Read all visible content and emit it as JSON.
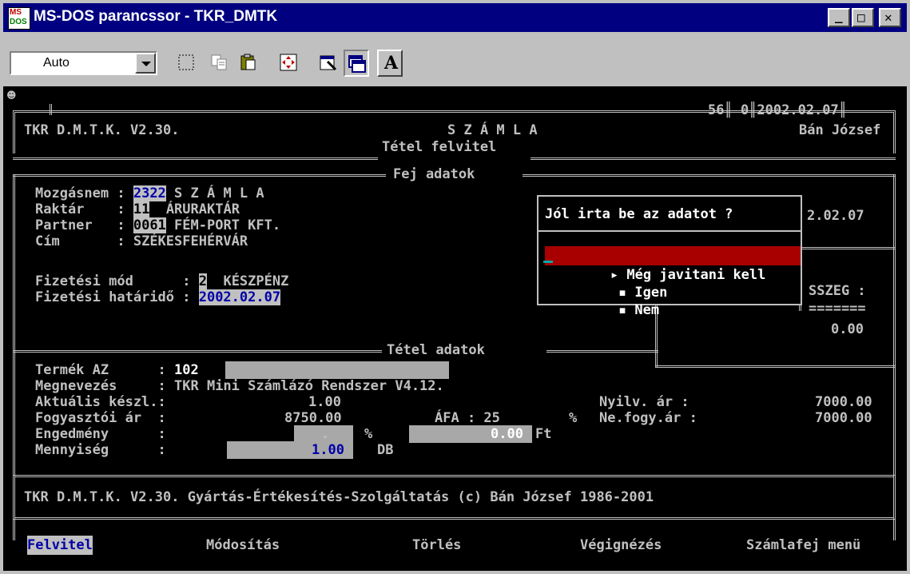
{
  "window": {
    "title": "MS-DOS parancssor - TKR_DMTK",
    "app_icon_top": "MS",
    "app_icon_bottom": "DOS",
    "minimize_glyph": "_",
    "maximize_glyph": "□",
    "close_glyph": "✕"
  },
  "toolbar": {
    "font_size_value": "Auto",
    "buttons": [
      "mark-icon",
      "copy-icon",
      "paste-icon",
      "fullscreen-icon",
      "properties-icon",
      "background-icon",
      "font-icon"
    ],
    "font_button_label": "A"
  },
  "console": {
    "smiley": "☻",
    "header": {
      "counters": "56║ 0║2002.02.07║",
      "app_name": "TKR D.M.T.K. V2.30.",
      "doc_title": "S Z Á M L A",
      "user": "Bán József",
      "section_tetel": "Tétel felvitel",
      "section_fej": "Fej adatok"
    },
    "fej": {
      "mozgasnem_label": "Mozgásnem :",
      "mozgasnem_code": "2322",
      "mozgasnem_name": "S Z Á M L A",
      "raktar_label": "Raktár    :",
      "raktar_code": "11",
      "raktar_name": "ÁRURAKTÁR",
      "partner_label": "Partner   :",
      "partner_code": "0061",
      "partner_name": "FÉM-PORT KFT.",
      "cim_label": "Cím       :",
      "cim_value": "SZÉKESFEHÉRVÁR",
      "fizmod_label": "Fizetési mód      :",
      "fizmod_code": "2",
      "fizmod_name": "KÉSZPÉNZ",
      "hatarido_label": "Fizetési határidő :",
      "hatarido_value": "2002.02.07",
      "right_date": "2.02.07",
      "right_osszeg": "SSZEG :",
      "right_sep": "=======",
      "right_amount": "0.00"
    },
    "dialog": {
      "question": "Jól irta be az adatot ?",
      "options": [
        "Még javitani kell",
        "Igen",
        "Nem"
      ],
      "selected_marker": "▸",
      "bullet": "▪"
    },
    "tetel": {
      "section": "Tétel adatok",
      "termek_label": "Termék AZ      :",
      "termek_value": "102",
      "megnev_label": "Megnevezés     :",
      "megnev_value": "TKR Mini Számlázó Rendszer V4.12.",
      "keszl_label": "Aktuális készl.:",
      "keszl_value": "1.00",
      "nyilv_label": "Nyilv. ár :",
      "nyilv_value": "7000.00",
      "fogy_label": "Fogyasztói ár  :",
      "fogy_value": "8750.00",
      "afa_label": "ÁFA : 25",
      "afa_pct": "%",
      "nefogy_label": "Ne.fogy.ár :",
      "nefogy_value": "7000.00",
      "eng_label": "Engedmény      :",
      "eng_value": ".",
      "eng_pct": "%",
      "eng_ft_value": "0.00",
      "eng_ft": "Ft",
      "menny_label": "Mennyiség      :",
      "menny_value": "1.00",
      "menny_unit": "DB"
    },
    "footer": "TKR D.M.T.K. V2.30. Gyártás-Értékesítés-Szolgáltatás (c) Bán József 1986-2001",
    "menu": [
      "Felvitel",
      "Módosítás",
      "Törlés",
      "Végignézés",
      "Számlafej menü"
    ]
  },
  "colors": {
    "titlebar": "#000080",
    "console_bg": "#000000",
    "console_text": "#c0c0c0",
    "highlight_blue": "#0000a8",
    "selection_red": "#a80000"
  }
}
